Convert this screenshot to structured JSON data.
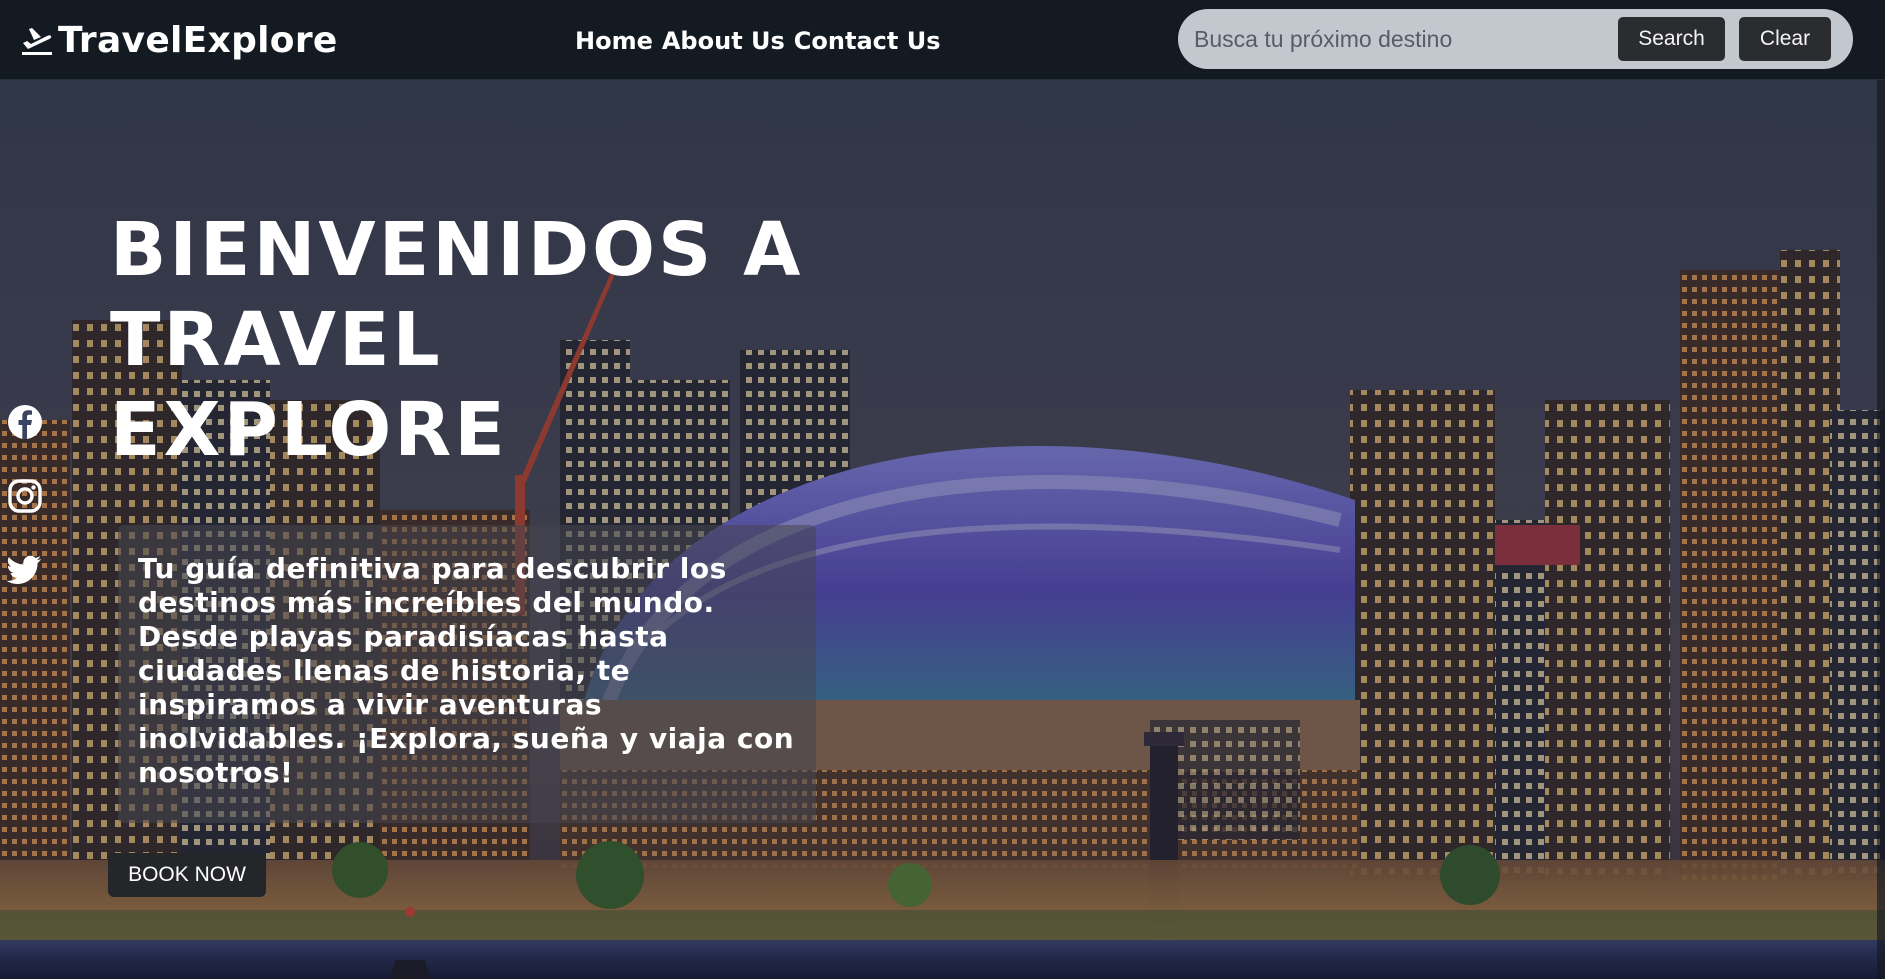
{
  "header": {
    "logo_text": "TravelExplore",
    "logo_icon": "plane-departure-icon",
    "nav": [
      {
        "label": "Home"
      },
      {
        "label": "About Us"
      },
      {
        "label": "Contact Us"
      }
    ],
    "search": {
      "placeholder": "Busca tu próximo destino",
      "value": "",
      "search_label": "Search",
      "clear_label": "Clear"
    }
  },
  "hero": {
    "title": "BIENVENIDOS A TRAVEL EXPLORE",
    "description": "Tu guía definitiva para descubrir los destinos más increíbles del mundo. Desde playas paradisíacas hasta ciudades llenas de historia, te inspiramos a vivir aventuras inolvidables. ¡Explora, sueña y viaja con nosotros!",
    "cta_label": "BOOK NOW",
    "background_image": "night city skyline with illuminated stadium dome by the water"
  },
  "social": [
    {
      "icon": "facebook-icon"
    },
    {
      "icon": "instagram-icon"
    },
    {
      "icon": "twitter-icon"
    }
  ],
  "colors": {
    "header_bg": "#141a22",
    "search_bg": "#c3c7ce",
    "button_dark": "#2a2c30",
    "text_white": "#ffffff",
    "dome_purple": "#6a5acd"
  }
}
